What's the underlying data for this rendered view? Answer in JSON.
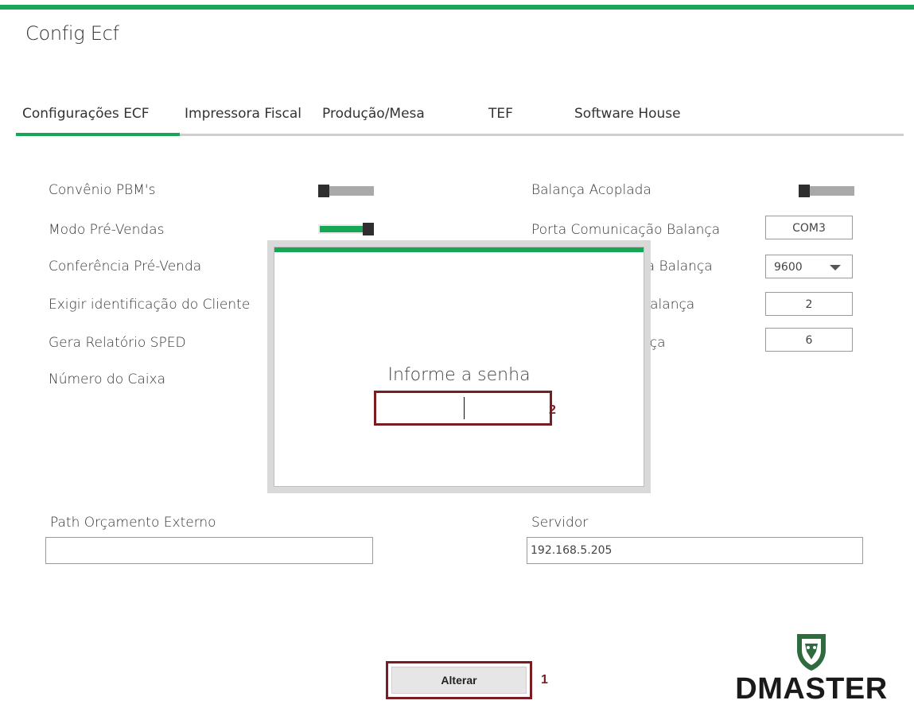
{
  "window": {
    "title": "Config Ecf"
  },
  "colors": {
    "accent": "#17a556",
    "highlight": "#7a1c22"
  },
  "tabs": [
    {
      "label": "Configurações ECF",
      "active": true
    },
    {
      "label": "Impressora Fiscal",
      "active": false
    },
    {
      "label": "Produção/Mesa",
      "active": false
    },
    {
      "label": "TEF",
      "active": false
    },
    {
      "label": "Software House",
      "active": false
    }
  ],
  "left_settings": {
    "convenio_pbm": {
      "label": "Convênio PBM's",
      "enabled": false
    },
    "modo_pre_vendas": {
      "label": "Modo Pré-Vendas",
      "enabled": true
    },
    "conferencia_pre_venda": {
      "label": "Conferência Pré-Venda"
    },
    "exigir_identificacao": {
      "label": "Exigir identificação do Cliente"
    },
    "gera_relatorio_sped": {
      "label": "Gera Relatório SPED"
    },
    "numero_caixa": {
      "label": "Número do Caixa"
    }
  },
  "right_settings": {
    "balanca_acoplada": {
      "label": "Balança Acoplada",
      "enabled": false
    },
    "porta_comunicacao": {
      "label": "Porta Comunicação Balança",
      "value": "COM3"
    },
    "velocidade_porta": {
      "label_partial": "ta Balança",
      "value": "9600"
    },
    "field_partial_2": {
      "label_partial": "Balança",
      "value": "2"
    },
    "field_partial_3": {
      "label_partial": "nça",
      "value": "6"
    }
  },
  "path_orcamento": {
    "label": "Path Orçamento Externo",
    "value": ""
  },
  "servidor": {
    "label": "Servidor",
    "value": "192.168.5.205"
  },
  "password_dialog": {
    "prompt": "Informe a senha",
    "value": "",
    "marker": "2"
  },
  "alterar": {
    "label": "Alterar",
    "marker": "1"
  },
  "logo": {
    "text": "DMASTER",
    "icon": "lion-shield-icon"
  }
}
